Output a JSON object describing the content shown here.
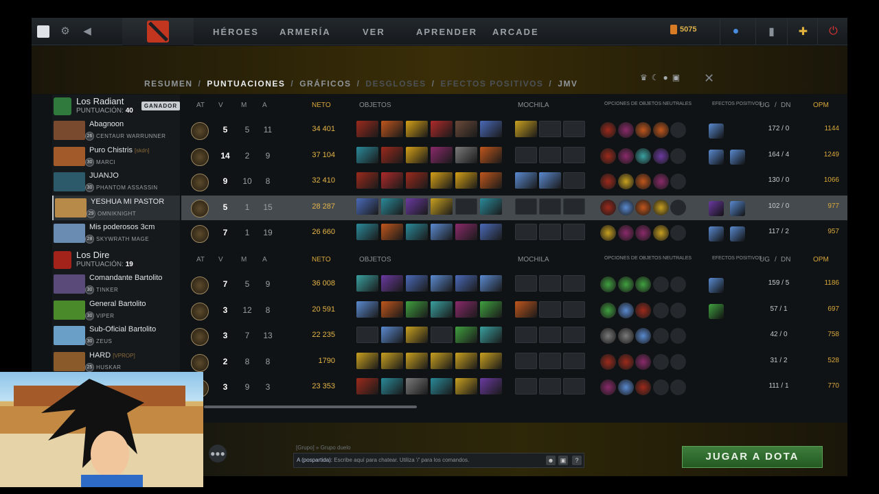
{
  "topbar": {
    "nav": [
      "HÉROES",
      "ARMERÍA",
      "VER",
      "APRENDER",
      "ARCADE"
    ],
    "shards": "5075"
  },
  "tabs": {
    "resumen": "RESUMEN",
    "puntuaciones": "PUNTUACIONES",
    "graficos": "GRÁFICOS",
    "desgloses": "DESGLOSES",
    "efectos": "EFECTOS POSITIVOS",
    "jmv": "JMV",
    "sep": "/"
  },
  "columns": {
    "at": "AT",
    "v": "V",
    "m": "M",
    "a": "A",
    "neto": "NETO",
    "objetos": "OBJETOS",
    "mochila": "MOCHILA",
    "neutrales": "OPCIONES DE OBJETOS NEUTRALES",
    "efectos": "EFECTOS POSITIVOS",
    "ug": "UG",
    "slash": "/",
    "dn": "DN",
    "opm": "OPM"
  },
  "radiant": {
    "name": "Los Radiant",
    "score_label": "PUNTUACIÓN:",
    "score": "40",
    "winner": "GANADOR",
    "players": [
      {
        "name": "Abagnoon",
        "tag": "",
        "level": "26",
        "hero": "CENTAUR WARRUNNER",
        "k": "5",
        "d": "5",
        "a": "11",
        "nw": "34 401",
        "lh": "172 / 0",
        "gpm": "1144"
      },
      {
        "name": "Puro Chistris",
        "tag": "[skdn]",
        "level": "30",
        "hero": "MARCI",
        "k": "14",
        "d": "2",
        "a": "9",
        "nw": "37 104",
        "lh": "164 / 4",
        "gpm": "1249"
      },
      {
        "name": "JUANJO",
        "tag": "",
        "level": "30",
        "hero": "PHANTOM ASSASSIN",
        "k": "9",
        "d": "10",
        "a": "8",
        "nw": "32 410",
        "lh": "130 / 0",
        "gpm": "1066"
      },
      {
        "name": "YESHUA MI PASTOR",
        "tag": "",
        "level": "29",
        "hero": "OMNIKNIGHT",
        "k": "5",
        "d": "1",
        "a": "15",
        "nw": "28 287",
        "lh": "102 / 0",
        "gpm": "977"
      },
      {
        "name": "Mis poderosos 3cm",
        "tag": "",
        "level": "28",
        "hero": "SKYWRATH MAGE",
        "k": "7",
        "d": "1",
        "a": "19",
        "nw": "26 660",
        "lh": "117 / 2",
        "gpm": "957"
      }
    ]
  },
  "dire": {
    "name": "Los Dire",
    "score_label": "PUNTUACIÓN:",
    "score": "19",
    "players": [
      {
        "name": "Comandante Bartolito",
        "tag": "",
        "level": "30",
        "hero": "TINKER",
        "k": "7",
        "d": "5",
        "a": "9",
        "nw": "36 008",
        "lh": "159 / 5",
        "gpm": "1186"
      },
      {
        "name": "General Bartolito",
        "tag": "",
        "level": "30",
        "hero": "VIPER",
        "k": "3",
        "d": "12",
        "a": "8",
        "nw": "20 591",
        "lh": "57 / 1",
        "gpm": "697"
      },
      {
        "name": "Sub-Oficial Bartolito",
        "tag": "",
        "level": "30",
        "hero": "ZEUS",
        "k": "3",
        "d": "7",
        "a": "13",
        "nw": "22 235",
        "lh": "42 / 0",
        "gpm": "758"
      },
      {
        "name": "HARD",
        "tag": "[VPROP]",
        "level": "25",
        "hero": "HUSKAR",
        "k": "2",
        "d": "8",
        "a": "8",
        "nw": "1790",
        "lh": "31 / 2",
        "gpm": "528"
      },
      {
        "name": "",
        "tag": "",
        "level": "",
        "hero": "",
        "k": "3",
        "d": "9",
        "a": "3",
        "nw": "23 353",
        "lh": "111 / 1",
        "gpm": "770"
      }
    ]
  },
  "chat": {
    "group_label": "[Grupo] » Grupo duelo",
    "channel": "A (pospartida):",
    "placeholder": "Escribe aquí para chatear. Utiliza '/' para los comandos."
  },
  "play_button": "JUGAR A DOTA",
  "colors": {
    "accent_gold": "#d9a83a",
    "play_green": "#2f6b2d",
    "bg": "#101315"
  }
}
